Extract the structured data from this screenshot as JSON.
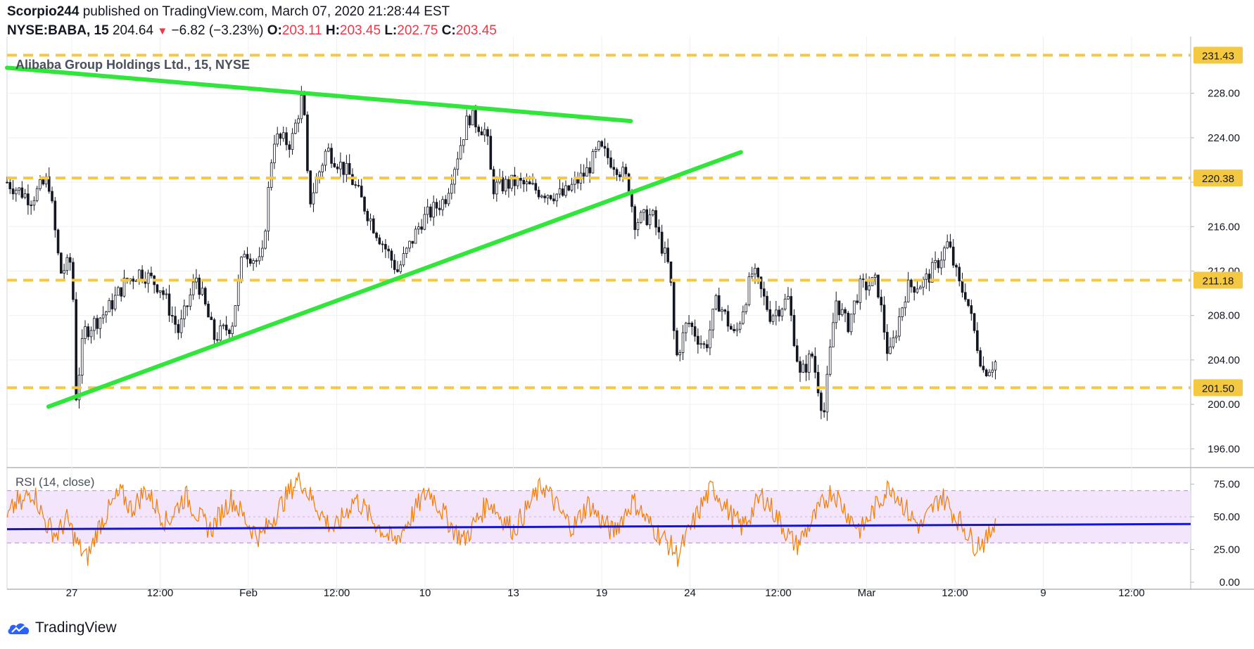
{
  "header": {
    "author": "Scorpio244",
    "published_text": "published on TradingView.com, March 07, 2020 21:28:44 EST",
    "symbol": "NYSE:BABA, 15",
    "last": "204.64",
    "change": "−6.82 (−3.23%)",
    "o_label": "O:",
    "o": "203.11",
    "h_label": "H:",
    "h": "203.45",
    "l_label": "L:",
    "l": "202.75",
    "c_label": "C:",
    "c": "203.45"
  },
  "footer": {
    "brand": "TradingView"
  },
  "colors": {
    "candle": "#131722",
    "trendline": "#31e63a",
    "level": "#f5c842",
    "rsi_line": "#f57c00",
    "rsi_ma": "#1414d6",
    "rsi_band": "#f3e5fb",
    "rsi_band_border": "#b08ad0"
  },
  "chart_data": [
    {
      "type": "candlestick",
      "title": "Alibaba Group Holdings Ltd., 15, NYSE",
      "ylim": [
        194.5,
        232.6
      ],
      "y_ticks": [
        "196.00",
        "200.00",
        "204.00",
        "208.00",
        "212.00",
        "216.00",
        "220.00",
        "224.00",
        "228.00"
      ],
      "x_ticks": [
        "27",
        "12:00",
        "Feb",
        "12:00",
        "10",
        "13",
        "19",
        "24",
        "12:00",
        "Mar",
        "12:00",
        "9",
        "12:00"
      ],
      "horizontal_levels": [
        {
          "label": "231.43",
          "value": 231.43
        },
        {
          "label": "220.38",
          "value": 220.38
        },
        {
          "label": "211.18",
          "value": 211.18
        },
        {
          "label": "201.50",
          "value": 201.5
        }
      ],
      "trendlines": [
        {
          "name": "resistance",
          "points": [
            [
              0.0,
              230.3
            ],
            [
              0.527,
              225.5
            ]
          ]
        },
        {
          "name": "support",
          "points": [
            [
              0.035,
              199.8
            ],
            [
              0.62,
              222.7
            ]
          ]
        }
      ],
      "price_path": [
        [
          0.0,
          220.0
        ],
        [
          0.02,
          218.5
        ],
        [
          0.035,
          220.3
        ],
        [
          0.045,
          211.8
        ],
        [
          0.055,
          213.0
        ],
        [
          0.058,
          200.5
        ],
        [
          0.065,
          206.5
        ],
        [
          0.085,
          208.5
        ],
        [
          0.1,
          211.0
        ],
        [
          0.113,
          212.0
        ],
        [
          0.13,
          210.5
        ],
        [
          0.145,
          206.5
        ],
        [
          0.16,
          211.5
        ],
        [
          0.175,
          206.0
        ],
        [
          0.19,
          207.2
        ],
        [
          0.2,
          214.0
        ],
        [
          0.215,
          212.5
        ],
        [
          0.225,
          224.0
        ],
        [
          0.24,
          223.5
        ],
        [
          0.25,
          228.0
        ],
        [
          0.255,
          218.0
        ],
        [
          0.27,
          223.0
        ],
        [
          0.29,
          220.5
        ],
        [
          0.31,
          216.0
        ],
        [
          0.33,
          212.0
        ],
        [
          0.35,
          216.5
        ],
        [
          0.37,
          218.5
        ],
        [
          0.39,
          226.0
        ],
        [
          0.405,
          224.5
        ],
        [
          0.41,
          219.5
        ],
        [
          0.43,
          220.0
        ],
        [
          0.45,
          219.2
        ],
        [
          0.47,
          218.8
        ],
        [
          0.49,
          221.0
        ],
        [
          0.5,
          223.0
        ],
        [
          0.515,
          221.5
        ],
        [
          0.525,
          220.0
        ],
        [
          0.53,
          216.5
        ],
        [
          0.545,
          217.0
        ],
        [
          0.56,
          212.0
        ],
        [
          0.565,
          204.0
        ],
        [
          0.575,
          207.5
        ],
        [
          0.59,
          205.0
        ],
        [
          0.6,
          209.5
        ],
        [
          0.615,
          206.0
        ],
        [
          0.63,
          212.0
        ],
        [
          0.645,
          208.0
        ],
        [
          0.66,
          209.5
        ],
        [
          0.67,
          202.5
        ],
        [
          0.68,
          204.5
        ],
        [
          0.69,
          199.0
        ],
        [
          0.7,
          209.5
        ],
        [
          0.71,
          207.0
        ],
        [
          0.72,
          210.5
        ],
        [
          0.735,
          211.0
        ],
        [
          0.745,
          204.0
        ],
        [
          0.76,
          210.5
        ],
        [
          0.775,
          211.0
        ],
        [
          0.785,
          212.5
        ],
        [
          0.795,
          214.5
        ],
        [
          0.805,
          210.5
        ],
        [
          0.81,
          210.0
        ],
        [
          0.815,
          207.5
        ],
        [
          0.825,
          203.0
        ],
        [
          0.835,
          203.8
        ]
      ]
    },
    {
      "type": "line",
      "title": "RSI (14, close)",
      "ylim": [
        0,
        86
      ],
      "y_ticks": [
        "75.00",
        "50.00",
        "25.00",
        "0.00"
      ],
      "band": [
        30,
        70
      ],
      "ma_line": [
        [
          0.0,
          40.5
        ],
        [
          1.0,
          44.5
        ]
      ],
      "series": [
        {
          "values": [
            48,
            55,
            62,
            58,
            66,
            70,
            64,
            52,
            44,
            40,
            36,
            42,
            48,
            40,
            30,
            24,
            18,
            26,
            38,
            46,
            52,
            58,
            64,
            68,
            62,
            56,
            60,
            66,
            70,
            64,
            58,
            52,
            46,
            50,
            56,
            62,
            66,
            60,
            54,
            48,
            44,
            40,
            46,
            52,
            58,
            64,
            60,
            54,
            48,
            42,
            38,
            34,
            40,
            46,
            52,
            58,
            64,
            70,
            76,
            80,
            72,
            66,
            60,
            54,
            48,
            44,
            40,
            46,
            52,
            58,
            64,
            60,
            56,
            50,
            46,
            42,
            38,
            34,
            30,
            36,
            42,
            48,
            54,
            60,
            66,
            70,
            64,
            58,
            52,
            46,
            40,
            36,
            32,
            38,
            44,
            50,
            56,
            62,
            58,
            52,
            48,
            44,
            40,
            46,
            52,
            58,
            64,
            70,
            74,
            68,
            62,
            56,
            50,
            46,
            42,
            48,
            54,
            60,
            56,
            50,
            46,
            42,
            38,
            44,
            50,
            56,
            62,
            58,
            52,
            46,
            42,
            38,
            34,
            30,
            26,
            20,
            28,
            36,
            44,
            52,
            60,
            66,
            72,
            68,
            62,
            56,
            50,
            46,
            42,
            48,
            54,
            60,
            66,
            62,
            56,
            50,
            44,
            38,
            32,
            28,
            34,
            40,
            46,
            52,
            58,
            64,
            70,
            66,
            60,
            54,
            48,
            44,
            40,
            46,
            52,
            58,
            64,
            70,
            74,
            68,
            62,
            56,
            50,
            46,
            42,
            48,
            54,
            60,
            66,
            62,
            56,
            50,
            46,
            40,
            34,
            28,
            32,
            30,
            38,
            50
          ]
        }
      ]
    }
  ]
}
